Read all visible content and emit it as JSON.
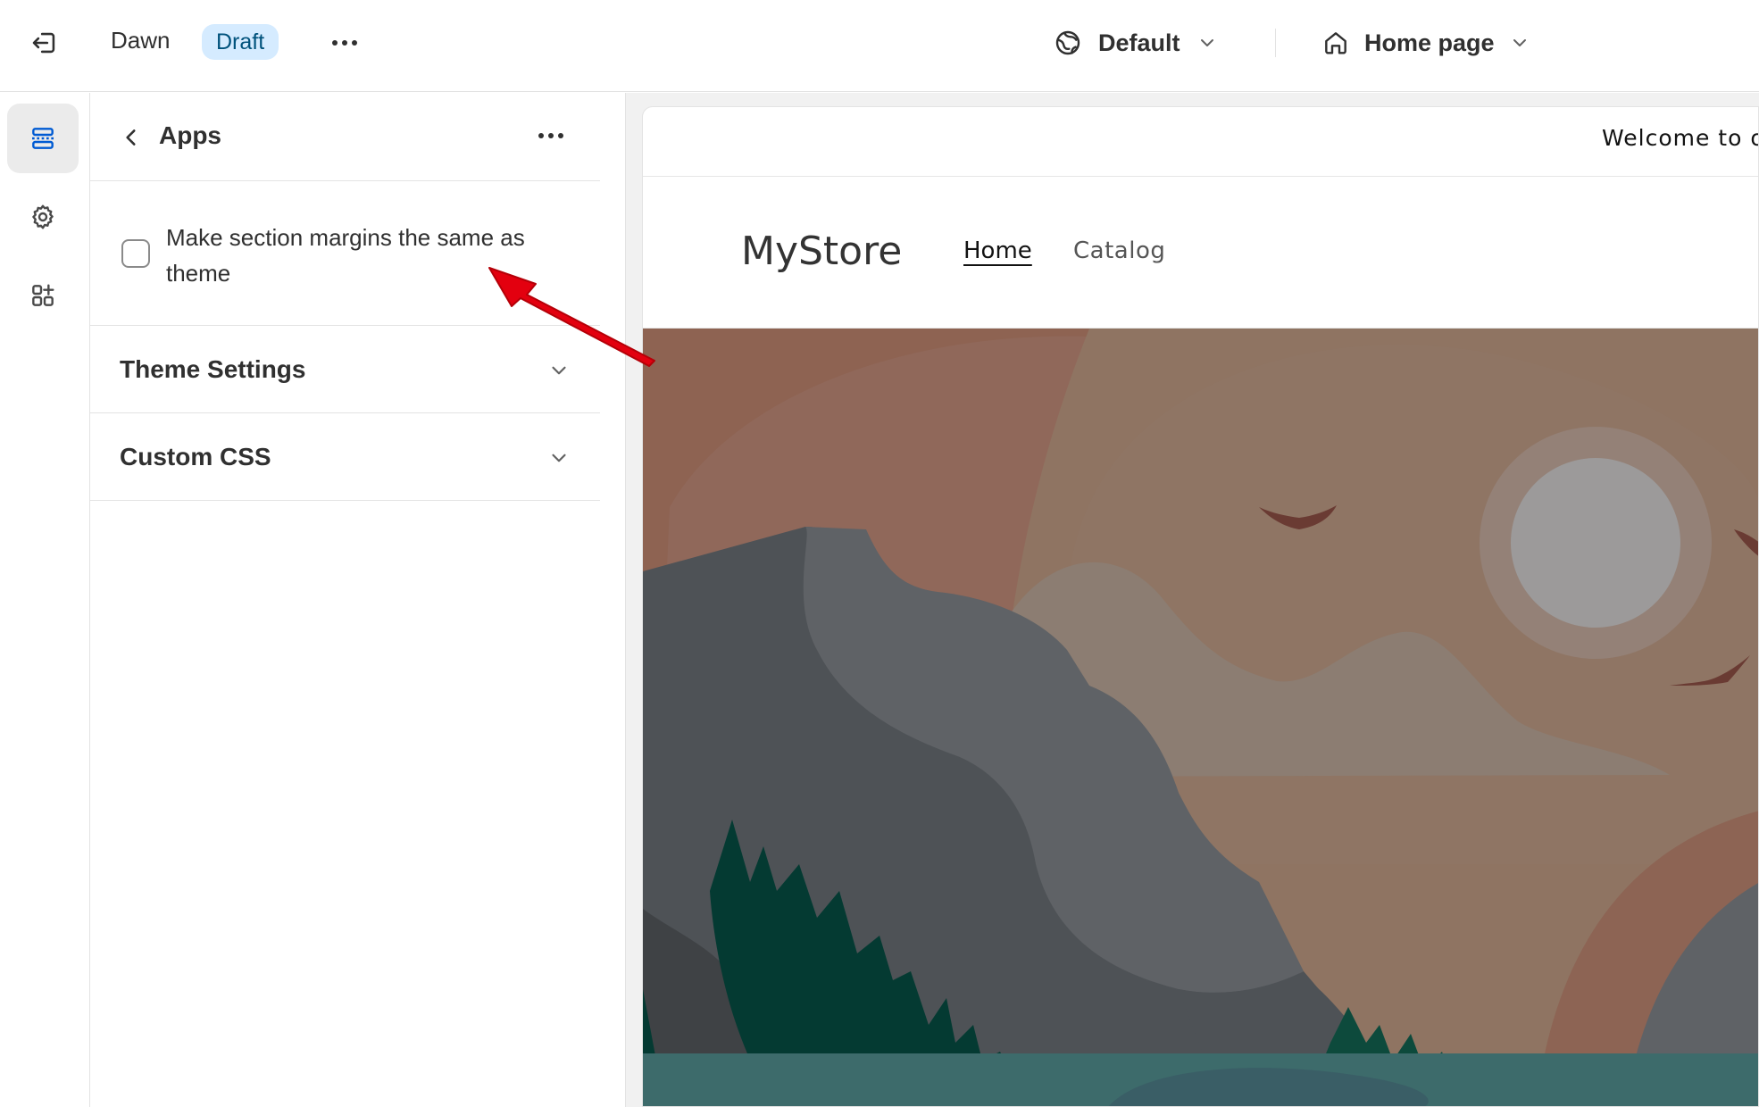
{
  "topbar": {
    "theme_name": "Dawn",
    "status_badge": "Draft",
    "locale_label": "Default",
    "page_label": "Home page"
  },
  "rail": {
    "items": [
      "sections-icon",
      "settings-icon",
      "apps-icon"
    ]
  },
  "panel": {
    "title": "Apps",
    "checkbox_label": "Make section margins the same as theme",
    "checkbox_checked": false,
    "accordions": [
      {
        "label": "Theme Settings"
      },
      {
        "label": "Custom CSS"
      }
    ]
  },
  "preview": {
    "announcement": "Welcome to ou",
    "store_name": "MyStore",
    "nav": [
      {
        "label": "Home"
      },
      {
        "label": "Catalog"
      }
    ]
  },
  "colors": {
    "accent": "#00527c",
    "badge_bg": "#d5ebff",
    "annotation_arrow": "#e3000f"
  }
}
